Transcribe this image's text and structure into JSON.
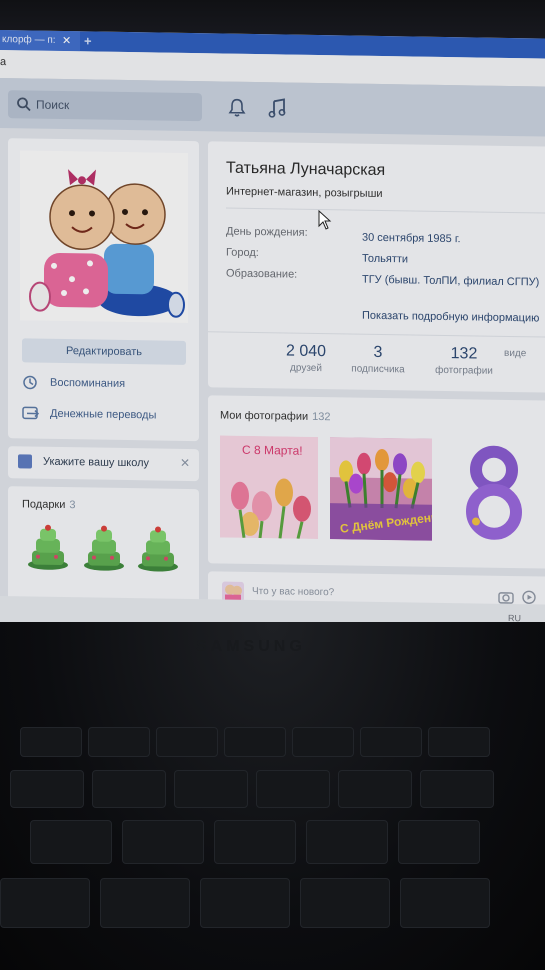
{
  "browser": {
    "tab_title": "клорф — п:",
    "tab_close": "✕",
    "new_tab": "+",
    "address_fragment": "а"
  },
  "header": {
    "search_placeholder": "Поиск",
    "icons": [
      "search-icon",
      "bell-icon",
      "music-icon"
    ]
  },
  "profile": {
    "name": "Татьяна Луначарская",
    "status": "Интернет-магазин, розыгрыши",
    "info": [
      {
        "label": "День рождения:",
        "value": "30 сентября 1985 г."
      },
      {
        "label": "Город:",
        "value": "Тольятти"
      },
      {
        "label": "Образование:",
        "value": "ТГУ (бывш. ТолПИ, филиал СГПУ)"
      }
    ],
    "show_more": "Показать подробную информацию",
    "stats": [
      {
        "count": "2 040",
        "label": "друзей"
      },
      {
        "count": "3",
        "label": "подписчика"
      },
      {
        "count": "132",
        "label": "фотографии"
      },
      {
        "count": "",
        "label": "виде"
      }
    ]
  },
  "sidebar": {
    "edit_label": "Редактировать",
    "menu": [
      {
        "label": "Воспоминания",
        "icon": "clock-history-icon"
      },
      {
        "label": "Денежные переводы",
        "icon": "money-transfer-icon"
      }
    ],
    "school_prompt": "Укажите вашу школу",
    "school_close": "✕",
    "gifts_title": "Подарки",
    "gifts_count": "3"
  },
  "photos": {
    "title": "Мои фотографии",
    "count": "132",
    "items": [
      {
        "caption": "С 8 Марта!"
      },
      {
        "caption": "С Днём Рождения!"
      },
      {
        "caption": "8"
      }
    ]
  },
  "post": {
    "placeholder": "Что у вас нового?"
  },
  "taskbar": {
    "language": "RU"
  },
  "laptop": {
    "brand": "SAMSUNG"
  },
  "colors": {
    "vk_link": "#2d4a77",
    "header_bg": "#c9d2df",
    "tab_bar": "#2d5fc2"
  }
}
